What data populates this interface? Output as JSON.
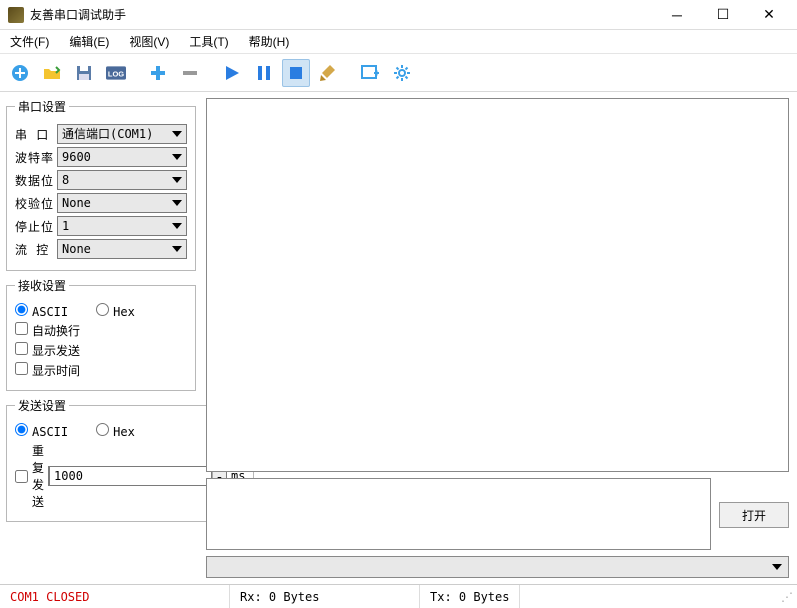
{
  "window": {
    "title": "友善串口调试助手"
  },
  "menu": {
    "file": "文件(F)",
    "edit": "编辑(E)",
    "view": "视图(V)",
    "tools": "工具(T)",
    "help": "帮助(H)"
  },
  "toolbar_icons": {
    "new": "new-icon",
    "open": "open-folder-icon",
    "save": "save-disk-icon",
    "log": "log-icon",
    "add": "plus-icon",
    "remove": "minus-icon",
    "start": "play-icon",
    "pause": "pause-icon",
    "stop": "stop-icon",
    "clear": "broom-icon",
    "window": "window-plus-icon",
    "settings": "gear-icon"
  },
  "serial_settings": {
    "legend": "串口设置",
    "port_label": "串  口",
    "port_value": "通信端口(COM1)",
    "baud_label": "波特率",
    "baud_value": "9600",
    "data_label": "数据位",
    "data_value": "8",
    "parity_label": "校验位",
    "parity_value": "None",
    "stop_label": "停止位",
    "stop_value": "1",
    "flow_label": "流  控",
    "flow_value": "None"
  },
  "recv_settings": {
    "legend": "接收设置",
    "ascii": "ASCII",
    "hex": "Hex",
    "wrap": "自动换行",
    "show_send": "显示发送",
    "show_time": "显示时间"
  },
  "send_settings": {
    "legend": "发送设置",
    "ascii": "ASCII",
    "hex": "Hex",
    "repeat": "重复发送",
    "interval": "1000",
    "unit": "ms"
  },
  "actions": {
    "open": "打开"
  },
  "status": {
    "port": "COM1 CLOSED",
    "rx": "Rx: 0 Bytes",
    "tx": "Tx: 0 Bytes"
  }
}
